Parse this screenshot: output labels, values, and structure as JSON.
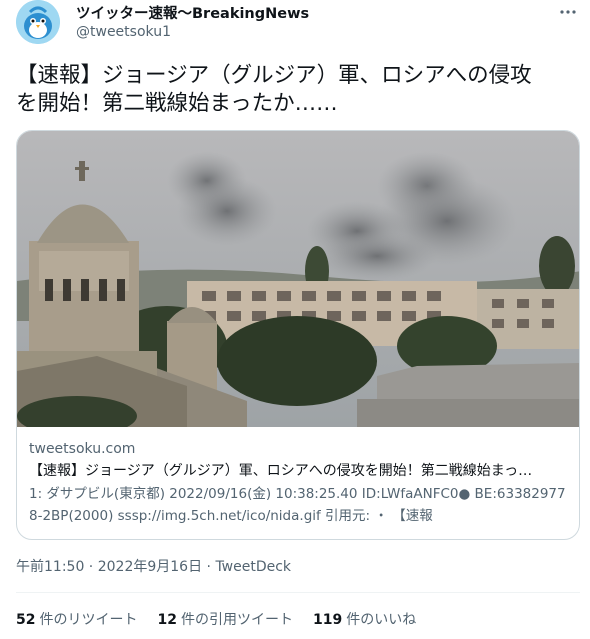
{
  "user": {
    "name": "ツイッター速報〜BreakingNews",
    "handle": "@tweetsoku1"
  },
  "tweet": {
    "text_line1": "【速報】ジョージア（グルジア）軍、ロシアへの侵攻",
    "text_line2": "を開始！第二戦線始まったか……"
  },
  "card": {
    "domain": "tweetsoku.com",
    "title": "【速報】ジョージア（グルジア）軍、ロシアへの侵攻を開始！第二戦線始まっ…",
    "description": "1: ダサプビル(東京都) 2022/09/16(金) 10:38:25.40 ID:LWfaANFC0● BE:633829778-2BP(2000) sssp://img.5ch.net/ico/nida.gif 引用元: ・ 【速報"
  },
  "meta": {
    "time": "午前11:50",
    "separator1": " · ",
    "date": "2022年9月16日",
    "separator2": " · ",
    "source": "TweetDeck"
  },
  "stats": {
    "retweets_count": "52",
    "retweets_label": "件のリツイート",
    "quotes_count": "12",
    "quotes_label": "件の引用ツイート",
    "likes_count": "119",
    "likes_label": "件のいいね"
  },
  "colors": {
    "text_primary": "#0f1419",
    "text_secondary": "#536471",
    "border": "#cfd9de",
    "avatar_bg": "#8ed0f0"
  },
  "icons": {
    "more": "more-dots-icon",
    "avatar": "bird-avatar-icon"
  }
}
